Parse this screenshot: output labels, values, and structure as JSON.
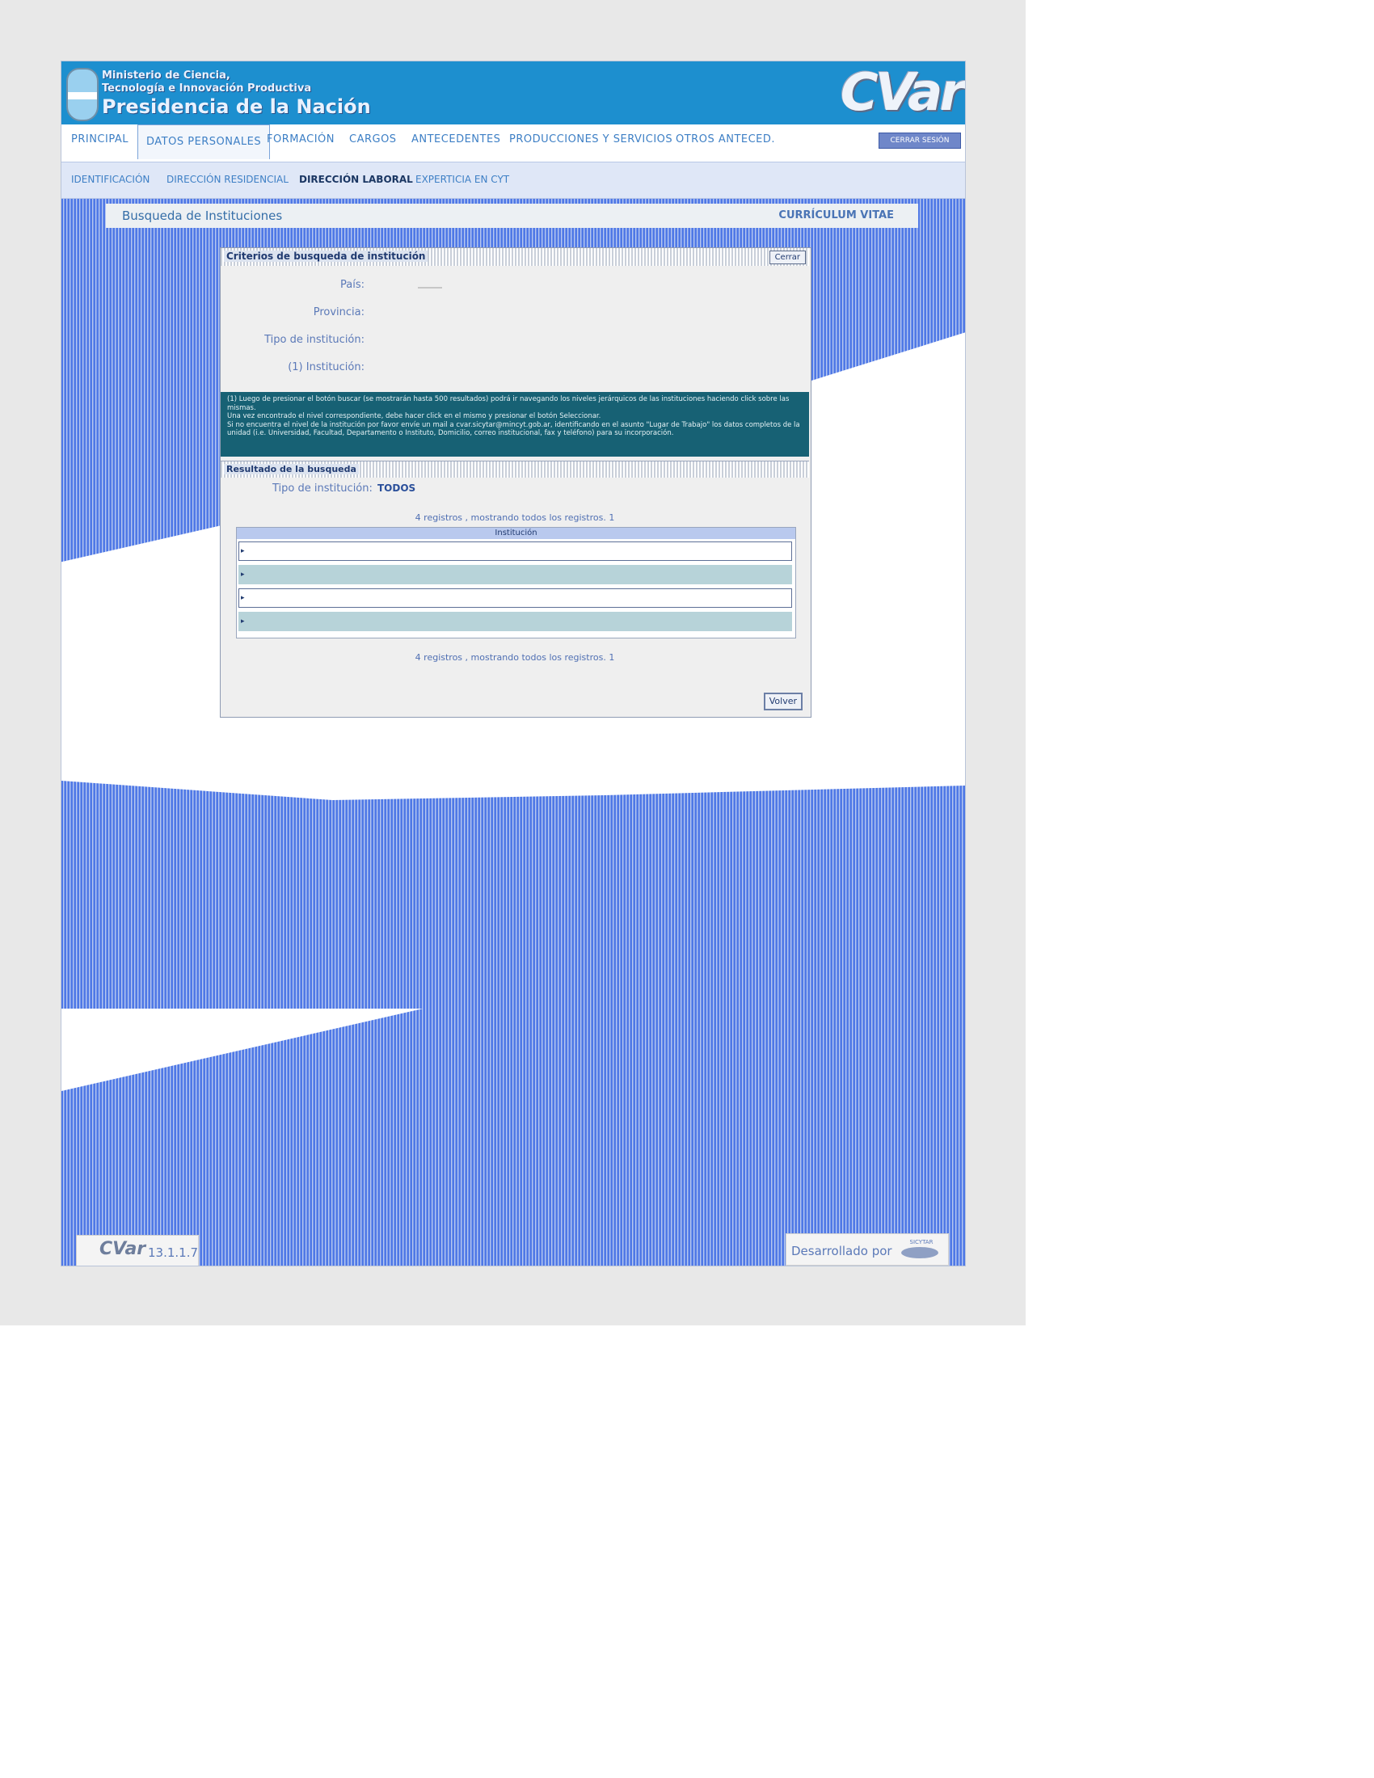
{
  "header": {
    "line1": "Ministerio de Ciencia,",
    "line2": "Tecnología e Innovación Productiva",
    "line3": "Presidencia de la Nación",
    "logo_text": "CVar"
  },
  "main_nav": {
    "tabs": [
      "PRINCIPAL",
      "DATOS PERSONALES",
      "FORMACIÓN",
      "CARGOS",
      "ANTECEDENTES",
      "PRODUCCIONES Y SERVICIOS",
      "OTROS ANTECED."
    ],
    "active": "DATOS PERSONALES",
    "logout_label": "CERRAR SESIÓN"
  },
  "sub_nav": {
    "tabs": [
      "IDENTIFICACIÓN",
      "DIRECCIÓN RESIDENCIAL",
      "DIRECCIÓN LABORAL",
      "EXPERTICIA EN CYT"
    ],
    "active": "DIRECCIÓN LABORAL"
  },
  "breadcrumb": {
    "title": "Busqueda de Instituciones",
    "right": "CURRÍCULUM VITAE"
  },
  "modal": {
    "title": "Criterios de busqueda de institución",
    "close_label": "Cerrar",
    "fields": {
      "pais_label": "País:",
      "provincia_label": "Provincia:",
      "tipo_label": "Tipo de institución:",
      "institucion_label": "(1) Institución:"
    },
    "help": {
      "p1": "(1) Luego de presionar el botón buscar (se mostrarán hasta 500 resultados) podrá ir navegando los niveles jerárquicos de las instituciones haciendo click sobre las mismas.",
      "p2": "Una vez encontrado el nivel correspondiente, debe hacer click en el mismo y presionar el botón Seleccionar.",
      "p3": "Si no encuentra el nivel de la institución por favor envíe un mail a cvar.sicytar@mincyt.gob.ar, identificando en el asunto \"Lugar de Trabajo\" los datos completos de la unidad (i.e. Universidad, Facultad, Departamento o Instituto, Domicilio, correo institucional, fax y teléfono) para su incorporación."
    },
    "results": {
      "title": "Resultado de la busqueda",
      "tipo_label": "Tipo de institución:",
      "tipo_value": "TODOS",
      "counter_top": "4 registros , mostrando todos los registros. 1",
      "counter_bottom": "4 registros , mostrando todos los registros. 1",
      "column_header": "Institución"
    },
    "back_label": "Volver"
  },
  "footer": {
    "logo": "CVar",
    "version": "13.1.1.7",
    "developed_by": "Desarrollado por",
    "brand": "SICYTAR"
  },
  "colors": {
    "header_blue": "#1d8fcf",
    "help_teal": "#176174",
    "stripe_blue": "#4f78e6",
    "row_alt": "#b7d3d9"
  }
}
